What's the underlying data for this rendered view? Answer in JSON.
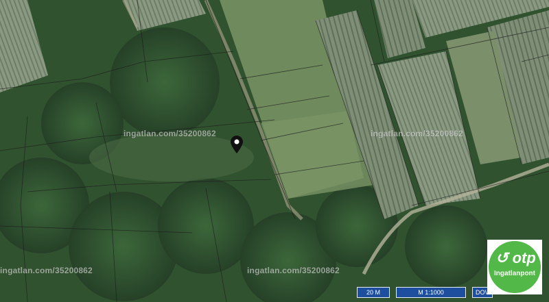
{
  "map": {
    "watermark_text": "ingatlan.com/35200862",
    "scale_distance": "20 M",
    "scale_ratio": "M 1:1000",
    "scale_extra": "DOV",
    "marker_icon": "map-pin-icon"
  },
  "logo": {
    "brand": "otp",
    "sub": "Ingatlanpont",
    "color": "#52b848"
  }
}
